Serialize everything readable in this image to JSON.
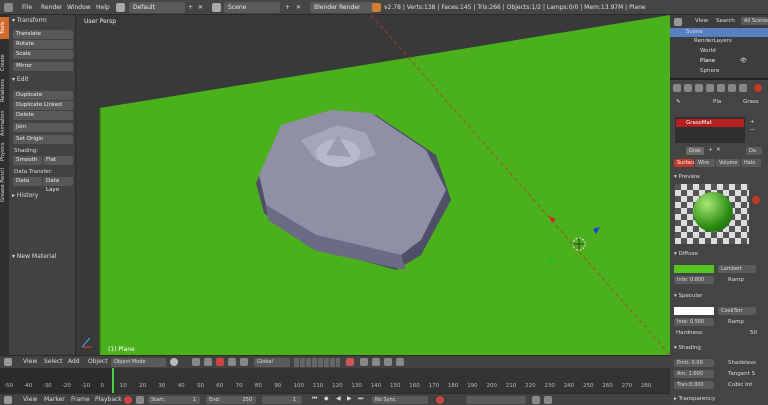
{
  "topbar": {
    "menus": [
      "File",
      "Render",
      "Window",
      "Help"
    ],
    "layout": "Default",
    "scene": "Scene",
    "engine": "Blender Render",
    "stats": "v2.78 | Verts:138 | Faces:145 | Tris:266 | Objects:1/2 | Lamps:0/0 | Mem:13.97M | Plane"
  },
  "tabs": [
    "Tools",
    "Create",
    "Relations",
    "Animation",
    "Physics",
    "Grease Pencil"
  ],
  "shelf": {
    "transform_title": "Transform",
    "translate": "Translate",
    "rotate": "Rotate",
    "scale": "Scale",
    "mirror": "Mirror",
    "edit_title": "Edit",
    "duplicate": "Duplicate",
    "duplicate_linked": "Duplicate Linked",
    "delete": "Delete",
    "join": "Join",
    "set_origin": "Set Origin",
    "shading_label": "Shading:",
    "smooth": "Smooth",
    "flat": "Flat",
    "data_transfer_label": "Data Transfer:",
    "data": "Data",
    "data_layo": "Data Layo",
    "history_title": "History",
    "new_material": "New Material"
  },
  "viewport": {
    "persp": "User Persp",
    "object_label": "(1) Plane"
  },
  "outliner": {
    "view": "View",
    "search": "Search",
    "all_scenes": "All Scenes",
    "items": [
      "Scene",
      "RenderLayers",
      "World",
      "Plane",
      "Sphere"
    ]
  },
  "props": {
    "pin_label": "Pla",
    "material_tab": "Grass",
    "material_slot": "GrassMat",
    "datablock": "Gras",
    "data_label": "Da",
    "subtabs": [
      "Surface",
      "Wire",
      "Volume",
      "Halo"
    ],
    "preview_title": "Preview",
    "diffuse_title": "Diffuse",
    "diffuse_shader": "Lambert",
    "diffuse_inten": "Inte: 0.800",
    "ramp": "Ramp",
    "specular_title": "Specular",
    "specular_shader": "CookTorr",
    "specular_inten": "Inte: 0.500",
    "hardness_label": "Hardness:",
    "hardness_value": "50",
    "shading_title": "Shading",
    "emit": "Emit: 0.00",
    "shadeless": "Shadeless",
    "ambient": "Am: 1.000",
    "tangent": "Tangent S",
    "translucency": "Tran:0.000",
    "cubic": "Cubic Int",
    "transparency_title": "Transparency",
    "colors": {
      "diffuse": "#55c41f",
      "specular": "#ffffff",
      "slot": "#b32020",
      "surface_tab": "#c0392b"
    }
  },
  "vheader": {
    "view": "View",
    "select": "Select",
    "add": "Add",
    "object": "Object",
    "mode": "Object Mode",
    "pivot": "Global"
  },
  "timeline": {
    "ticks": [
      "-50",
      "-40",
      "-30",
      "-20",
      "-10",
      "0",
      "10",
      "20",
      "30",
      "40",
      "50",
      "60",
      "70",
      "80",
      "90",
      "100",
      "110",
      "120",
      "130",
      "140",
      "150",
      "160",
      "170",
      "180",
      "190",
      "200",
      "210",
      "220",
      "230",
      "240",
      "250",
      "260",
      "270",
      "280"
    ]
  },
  "tlfooter": {
    "view": "View",
    "marker": "Marker",
    "frame": "Frame",
    "playback": "Playback",
    "start": "Start:",
    "start_val": "1",
    "end": "End:",
    "end_val": "250",
    "current": "1",
    "sync": "No Sync"
  },
  "colors": {
    "ground": "#4ab11c",
    "ground_dark": "#3f9c14",
    "accent": "#e06d2f"
  }
}
